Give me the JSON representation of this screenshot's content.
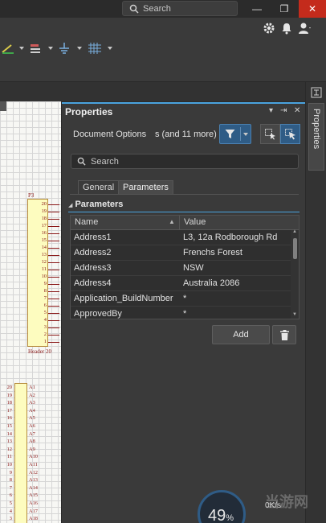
{
  "titlebar": {
    "search_placeholder": "Search",
    "minimize": "—",
    "restore": "❐",
    "close": "✕"
  },
  "toolbar": {
    "icons": [
      "wire-tool-icon",
      "bus-tool-icon",
      "ground-power-icon",
      "grid-icon",
      "gear-icon",
      "bell-icon",
      "user-icon"
    ]
  },
  "schematic": {
    "header_ref": "P3",
    "header_name": "Header 20",
    "header_pins": [
      "20",
      "19",
      "18",
      "17",
      "16",
      "15",
      "14",
      "13",
      "12",
      "11",
      "10",
      "9",
      "8",
      "7",
      "6",
      "5",
      "4",
      "3",
      "2",
      "1"
    ],
    "left_pins": [
      "20",
      "19",
      "18",
      "17",
      "16",
      "15",
      "14",
      "13",
      "12",
      "11",
      "10",
      "9",
      "8",
      "7",
      "6",
      "5",
      "4",
      "3"
    ],
    "right_pins": [
      "A1",
      "A2",
      "A3",
      "A4",
      "A5",
      "A6",
      "A7",
      "A8",
      "A9",
      "A10",
      "A11",
      "A12",
      "A13",
      "A14",
      "A15",
      "A16",
      "A17",
      "A18"
    ]
  },
  "panel": {
    "title": "Properties",
    "header_controls": [
      "▾",
      "⇥",
      "✕"
    ],
    "doc_options": "Document Options",
    "more_text": "s (and 11 more)",
    "search_placeholder": "Search",
    "tabs": [
      "General",
      "Parameters"
    ],
    "section_title": "Parameters",
    "columns": {
      "name": "Name",
      "value": "Value"
    },
    "rows": [
      {
        "name": "Address1",
        "value": "L3, 12a Rodborough Rd"
      },
      {
        "name": "Address2",
        "value": "Frenchs Forest"
      },
      {
        "name": "Address3",
        "value": "NSW"
      },
      {
        "name": "Address4",
        "value": "Australia 2086"
      },
      {
        "name": "Application_BuildNumber",
        "value": "*"
      },
      {
        "name": "ApprovedBy",
        "value": "*"
      }
    ],
    "add_label": "Add"
  },
  "dock": {
    "tab_label": "Properties"
  },
  "overlay": {
    "gauge_value": "49",
    "gauge_unit": "%",
    "net_speed": "0K/s",
    "watermark": "当游网"
  },
  "colors": {
    "accent": "#4aa3df",
    "close": "#c42b1c",
    "active_button": "#2f5c86"
  }
}
